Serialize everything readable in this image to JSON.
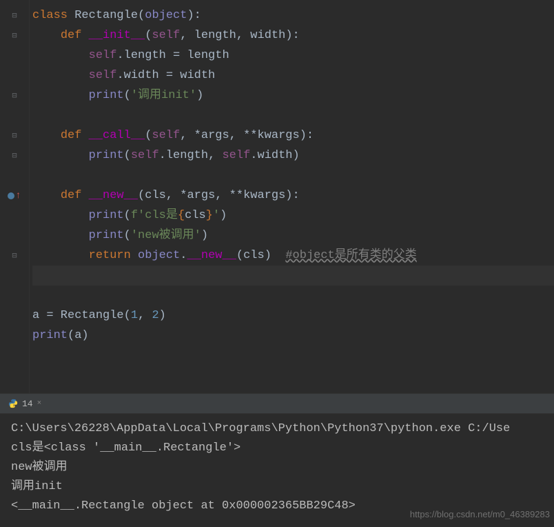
{
  "code": {
    "l1": {
      "kw": "class ",
      "name": "Rectangle",
      "p1": "(",
      "obj": "object",
      "p2": "):"
    },
    "l2": {
      "kw": "def ",
      "name": "__init__",
      "p1": "(",
      "self": "self",
      "c1": ", ",
      "a1": "length",
      "c2": ", ",
      "a2": "width",
      "p2": "):"
    },
    "l3": {
      "self": "self",
      "dot": ".length = length"
    },
    "l4": {
      "self": "self",
      "dot": ".width = width"
    },
    "l5": {
      "fn": "print",
      "p1": "(",
      "s": "'调用init'",
      "p2": ")"
    },
    "l7": {
      "kw": "def ",
      "name": "__call__",
      "p1": "(",
      "self": "self",
      "c1": ", *args, **kwargs):"
    },
    "l8": {
      "fn": "print",
      "p1": "(",
      "self1": "self",
      "d1": ".length, ",
      "self2": "self",
      "d2": ".width)"
    },
    "l10": {
      "kw": "def ",
      "name": "__new__",
      "p1": "(cls, *args, **kwargs):"
    },
    "l11": {
      "fn": "print",
      "p1": "(",
      "f": "f",
      "s1": "'cls是",
      "b1": "{",
      "v": "cls",
      "b2": "}",
      "s2": "'",
      "p2": ")"
    },
    "l12": {
      "fn": "print",
      "p1": "(",
      "s": "'new被调用'",
      "p2": ")"
    },
    "l13": {
      "kw": "return ",
      "obj": "object",
      "dot": ".",
      "dn": "__new__",
      "p": "(cls)",
      "sp": "  ",
      "c": "#object是所有类的父类"
    },
    "l16": {
      "v": "a = Rectangle(",
      "n1": "1",
      "c": ", ",
      "n2": "2",
      "p": ")"
    },
    "l17": {
      "fn": "print",
      "p": "(a)"
    }
  },
  "tab": {
    "label": "14",
    "close": "×"
  },
  "terminal": {
    "l1": "C:\\Users\\26228\\AppData\\Local\\Programs\\Python\\Python37\\python.exe C:/Use",
    "l2": "cls是<class '__main__.Rectangle'>",
    "l3": "new被调用",
    "l4": "调用init",
    "l5": "<__main__.Rectangle object at 0x000002365BB29C48>"
  },
  "watermark": "https://blog.csdn.net/m0_46389283"
}
